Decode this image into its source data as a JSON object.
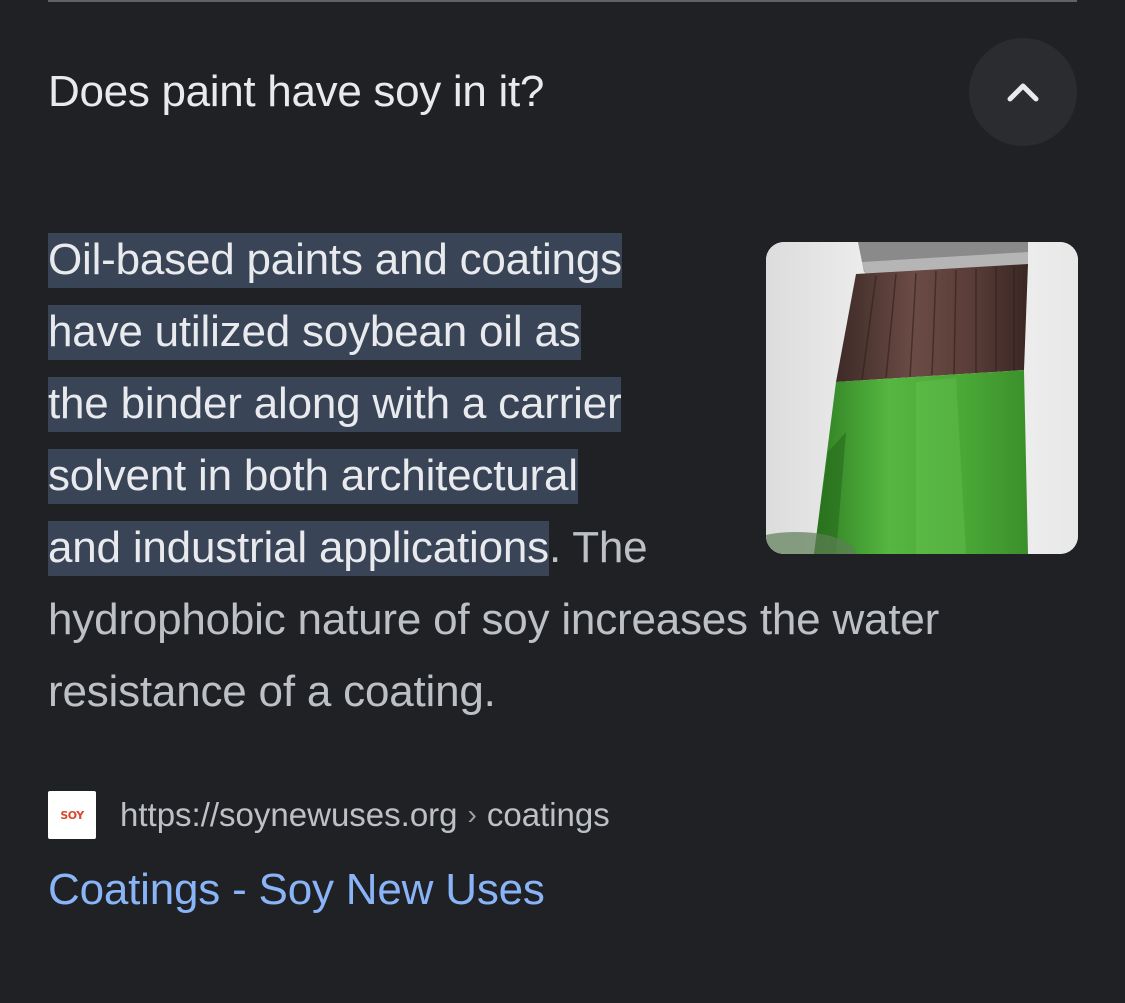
{
  "question": {
    "title": "Does paint have soy in it?",
    "collapse_icon": "chevron-up-icon"
  },
  "answer": {
    "highlighted_lines": [
      "Oil-based paints and coatings",
      "have utilized soybean oil as",
      "the binder along with a carrier",
      "solvent in both architectural",
      "and industrial applications"
    ],
    "rest_text": ". The hydrophobic nature of soy increases the water resistance of a coating.",
    "image_icon": "paintbrush-green-paint-image"
  },
  "source": {
    "favicon_label": "SOY",
    "url": "https://soynewuses.org",
    "separator": "›",
    "path": "coatings"
  },
  "result": {
    "link_text": "Coatings - Soy New Uses"
  },
  "colors": {
    "background": "#202124",
    "highlight": "#394457",
    "link": "#8ab4f8",
    "paint_green": "#4caf3a"
  }
}
